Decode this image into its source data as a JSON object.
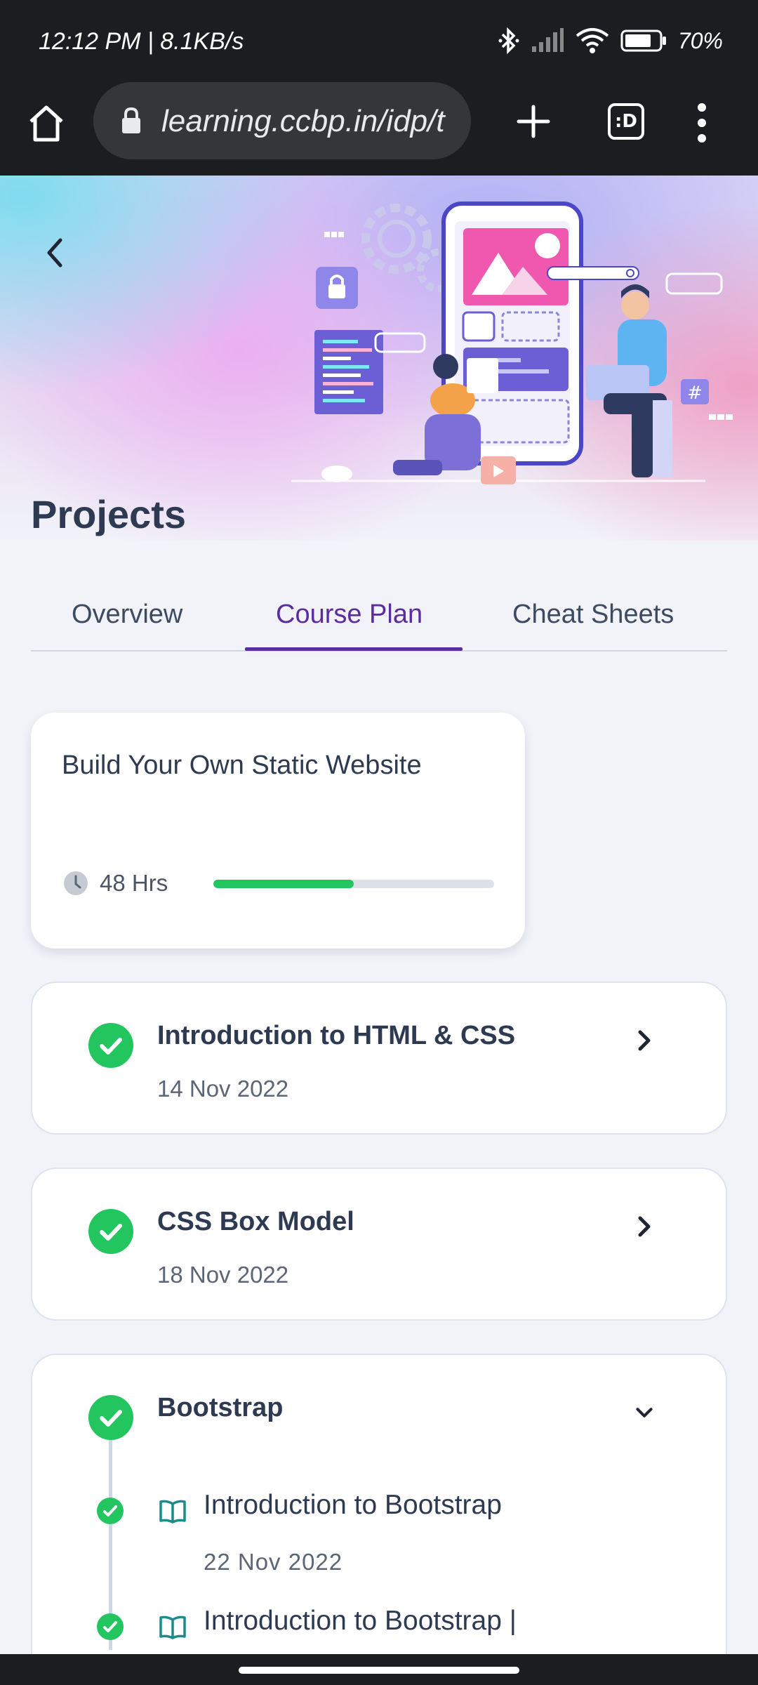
{
  "status_bar": {
    "time": "12:12 PM | 8.1KB/s",
    "battery": "70%",
    "icons": [
      "bluetooth-icon",
      "signal-icon",
      "wifi-icon",
      "battery-icon"
    ]
  },
  "browser": {
    "url": "learning.ccbp.in/idp/t",
    "tab_switcher_label": ":D"
  },
  "page": {
    "title": "Projects",
    "tabs": [
      {
        "label": "Overview",
        "active": false
      },
      {
        "label": "Course Plan",
        "active": true
      },
      {
        "label": "Cheat Sheets",
        "active": false
      }
    ]
  },
  "summary": {
    "title": "Build Your Own Static Website",
    "duration": "48 Hrs",
    "progress_fraction": 0.5
  },
  "topics": [
    {
      "title": "Introduction to HTML & CSS",
      "date": "14 Nov 2022",
      "completed": true,
      "expanded": false
    },
    {
      "title": "CSS Box Model",
      "date": "18 Nov 2022",
      "completed": true,
      "expanded": false
    },
    {
      "title": "Bootstrap",
      "completed": true,
      "expanded": true,
      "subtopics": [
        {
          "title": "Introduction to Bootstrap",
          "date": "22 Nov 2022",
          "completed": true
        },
        {
          "title": "Introduction to Bootstrap |",
          "completed": true
        }
      ]
    }
  ],
  "colors": {
    "accent": "#5b2ca0",
    "success": "#22c55e",
    "text_dark": "#2e3a52",
    "system_bar": "#1b1d20"
  }
}
